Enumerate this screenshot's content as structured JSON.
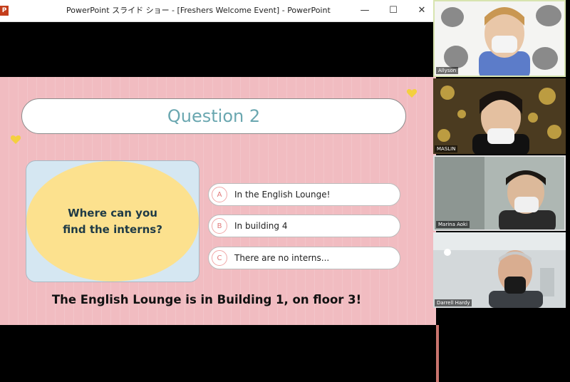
{
  "window": {
    "title": "PowerPoint スライド ショー - [Freshers Welcome Event] - PowerPoint",
    "app_icon": "powerpoint-icon",
    "min_symbol": "—",
    "max_symbol": "☐",
    "close_symbol": "✕"
  },
  "slide": {
    "title": "Question 2",
    "question": "Where can you find the interns?",
    "answers": [
      {
        "letter": "A",
        "text": "In the English Lounge!"
      },
      {
        "letter": "B",
        "text": "In building 4"
      },
      {
        "letter": "C",
        "text": "There are no interns..."
      }
    ],
    "note": "The English Lounge is in Building 1, on floor 3!",
    "colors": {
      "background": "#f1bcc1",
      "title": "#6aa7b0",
      "oval": "#fce18e",
      "card": "#d5e7f2",
      "heart": "#f4d03f"
    }
  },
  "participants": [
    {
      "name": "Allyson",
      "icon": "webcam-video"
    },
    {
      "name": "MASLIN",
      "icon": "webcam-video"
    },
    {
      "name": "Marina Aoki",
      "icon": "webcam-video"
    },
    {
      "name": "Darrell Hardy",
      "icon": "webcam-video"
    }
  ]
}
